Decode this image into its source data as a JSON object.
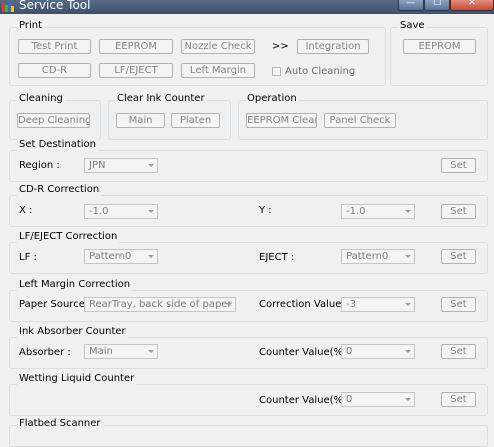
{
  "window": {
    "title": "Service Tool",
    "minimize_glyph": "—",
    "maximize_glyph": "☐",
    "close_glyph": "✕"
  },
  "print": {
    "label": "Print",
    "buttons": [
      "Test Print",
      "EEPROM",
      "Nozzle Check",
      "Integration",
      "CD-R",
      "LF/EJECT",
      "Left Margin"
    ],
    "arrow": ">>",
    "auto_cleaning_label": "Auto Cleaning",
    "auto_cleaning_checked": false
  },
  "save": {
    "label": "Save",
    "eeprom_button": "EEPROM"
  },
  "cleaning": {
    "label": "Cleaning",
    "deep_cleaning_button": "Deep Cleaning"
  },
  "clear_ink_counter": {
    "label": "Clear Ink Counter",
    "main_button": "Main",
    "platen_button": "Platen"
  },
  "operation": {
    "label": "Operation",
    "eeprom_clear_button": "EEPROM Clear",
    "panel_check_button": "Panel Check"
  },
  "set_destination": {
    "label": "Set Destination",
    "region_label": "Region :",
    "region_value": "JPN",
    "set_button": "Set"
  },
  "cdr_correction": {
    "label": "CD-R Correction",
    "x_label": "X :",
    "x_value": "-1.0",
    "y_label": "Y :",
    "y_value": "-1.0",
    "set_button": "Set"
  },
  "lf_eject_correction": {
    "label": "LF/EJECT Correction",
    "lf_label": "LF :",
    "lf_value": "Pattern0",
    "eject_label": "EJECT :",
    "eject_value": "Pattern0",
    "set_button": "Set"
  },
  "left_margin_correction": {
    "label": "Left Margin Correction",
    "paper_source_label": "Paper Source :",
    "paper_source_value": "RearTray, back side of paper",
    "correction_value_label": "Correction Value :",
    "correction_value": "-3",
    "set_button": "Set"
  },
  "ink_absorber_counter": {
    "label": "Ink Absorber Counter",
    "absorber_label": "Absorber :",
    "absorber_value": "Main",
    "counter_label": "Counter Value(%) :",
    "counter_value": "0",
    "set_button": "Set"
  },
  "wetting_liquid_counter": {
    "label": "Wetting Liquid Counter",
    "counter_label": "Counter Value(%) :",
    "counter_value": "0",
    "set_button": "Set"
  },
  "flatbed_scanner": {
    "label": "Flatbed Scanner"
  }
}
